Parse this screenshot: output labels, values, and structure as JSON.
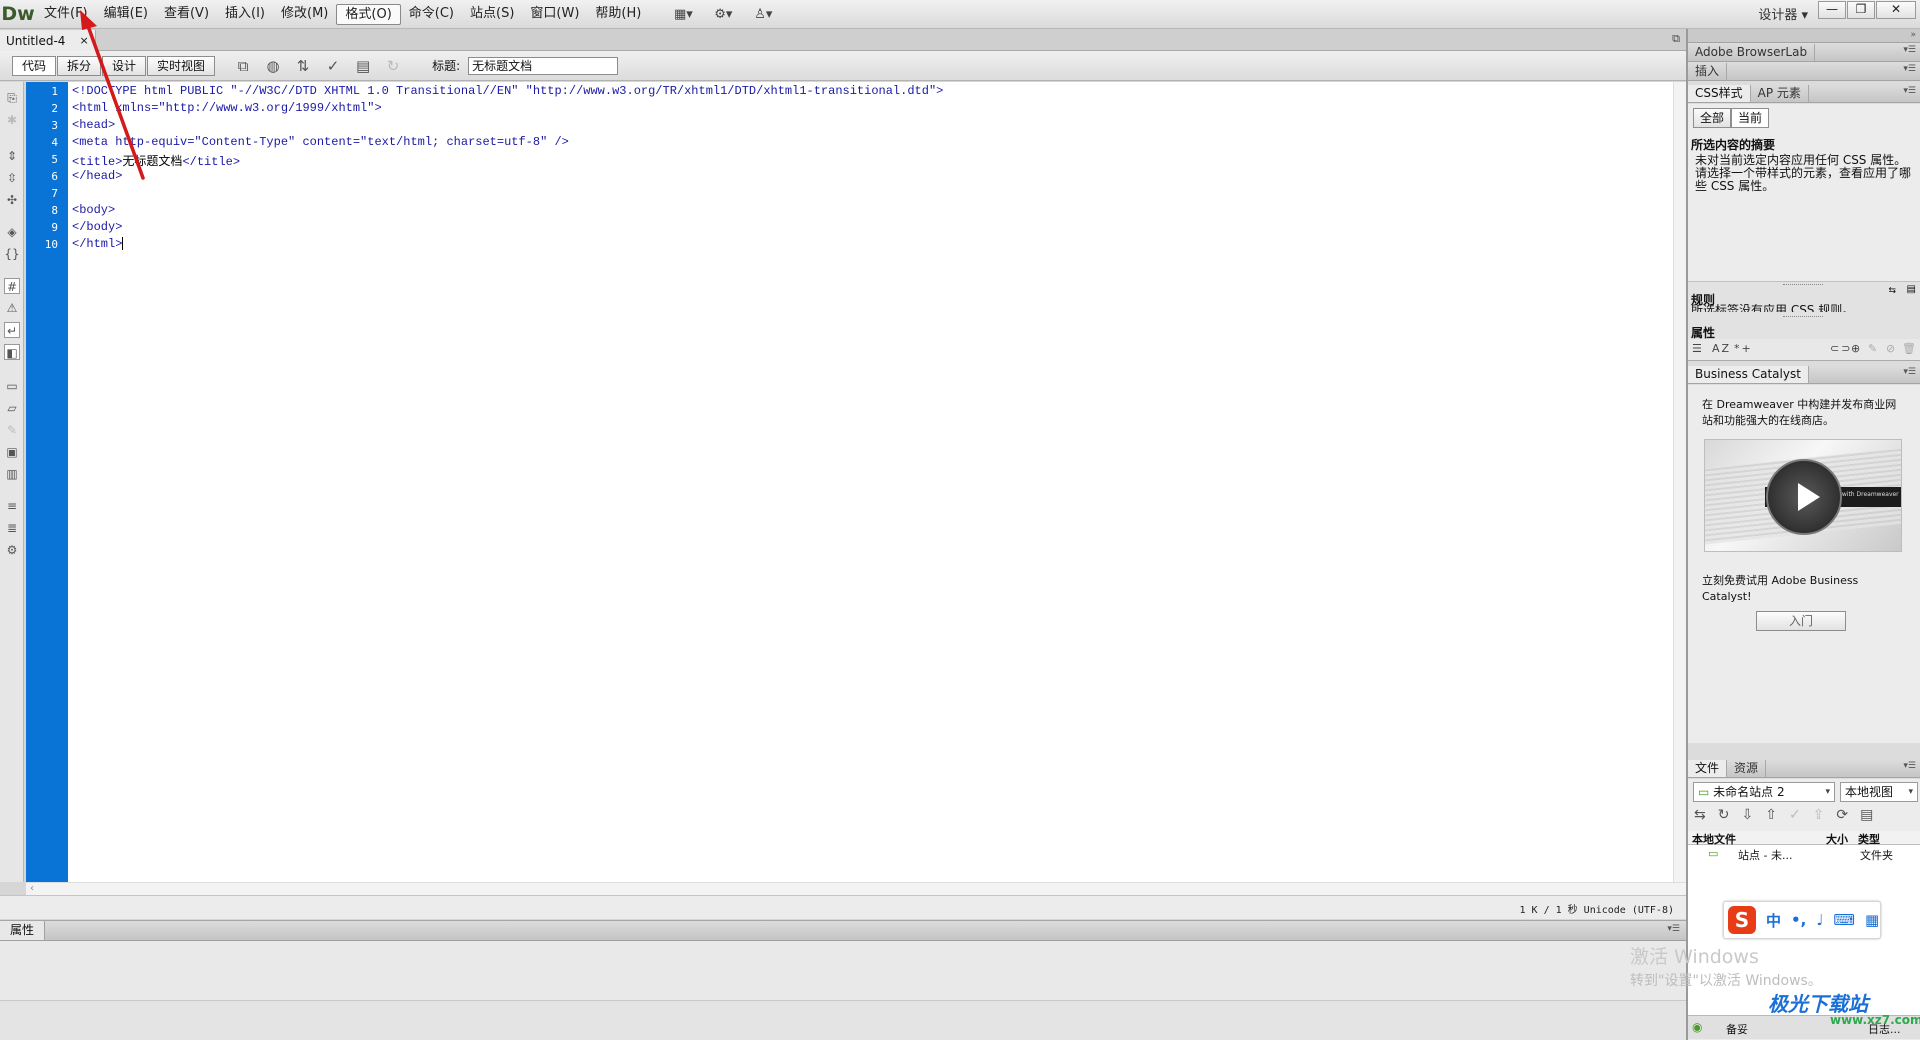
{
  "app": {
    "logo": "Dw",
    "menus": [
      "文件(F)",
      "编辑(E)",
      "查看(V)",
      "插入(I)",
      "修改(M)",
      "格式(O)",
      "命令(C)",
      "站点(S)",
      "窗口(W)",
      "帮助(H)"
    ],
    "workspace": "设计器",
    "window_controls": [
      "—",
      "❐",
      "✕"
    ]
  },
  "document": {
    "tab_name": "Untitled-4",
    "tab_close": "×",
    "views": [
      "代码",
      "拆分",
      "设计",
      "实时视图"
    ],
    "title_label": "标题:",
    "title_value": "无标题文档"
  },
  "code": {
    "line_numbers": [
      "1",
      "2",
      "3",
      "4",
      "5",
      "6",
      "7",
      "8",
      "9",
      "10"
    ],
    "lines": [
      "<!DOCTYPE html PUBLIC \"-//W3C//DTD XHTML 1.0 Transitional//EN\" \"http://www.w3.org/TR/xhtml1/DTD/xhtml1-transitional.dtd\">",
      "<html xmlns=\"http://www.w3.org/1999/xhtml\">",
      "<head>",
      "<meta http-equiv=\"Content-Type\" content=\"text/html; charset=utf-8\" />",
      "<title>",
      "</head>",
      "",
      "<body>",
      "</body>",
      "</html>"
    ],
    "title_text": "无标题文档",
    "title_close": "</title>"
  },
  "status": {
    "info": "1 K / 1 秒 Unicode (UTF-8)"
  },
  "properties": {
    "tab": "属性"
  },
  "right_panels": {
    "browserlab": "Adobe BrowserLab",
    "insert": "插入",
    "css_tab": "CSS样式",
    "ap_tab": "AP 元素",
    "all_btn": "全部",
    "current_btn": "当前",
    "summary_title": "所选内容的摘要",
    "summary_text": "未对当前选定内容应用任何 CSS 属性。请选择一个带样式的元素，查看应用了哪些 CSS 属性。",
    "rules_title": "规则",
    "rules_text": "所选标签没有应用 CSS 规则。",
    "props_title": "属性",
    "bc_title": "Business Catalyst",
    "bc_intro": "在 Dreamweaver 中构建并发布商业网站和功能强大的在线商店。",
    "bc_video_caption": "Business Catalyst with Dreamweaver",
    "bc_trial": "立刻免费试用 Adobe Business Catalyst!",
    "bc_enter": "入门",
    "files_tab": "文件",
    "assets_tab": "资源",
    "site_select": "未命名站点 2",
    "view_select": "本地视图",
    "col_local": "本地文件",
    "col_size": "大小",
    "col_type": "类型",
    "row_name": "站点 - 未...",
    "row_type": "文件夹",
    "bottom_left": "备妥",
    "bottom_right": "日志..."
  },
  "overlay": {
    "activate_title": "激活 Windows",
    "activate_sub": "转到\"设置\"以激活 Windows。",
    "site_logo": "极光下载站",
    "site_url": "www.xz7.com",
    "ime_s": "S",
    "ime_mode": "中"
  },
  "colors": {
    "gutter": "#0a73d6",
    "code_text": "#1a1aa6",
    "annotation": "#d31919"
  }
}
